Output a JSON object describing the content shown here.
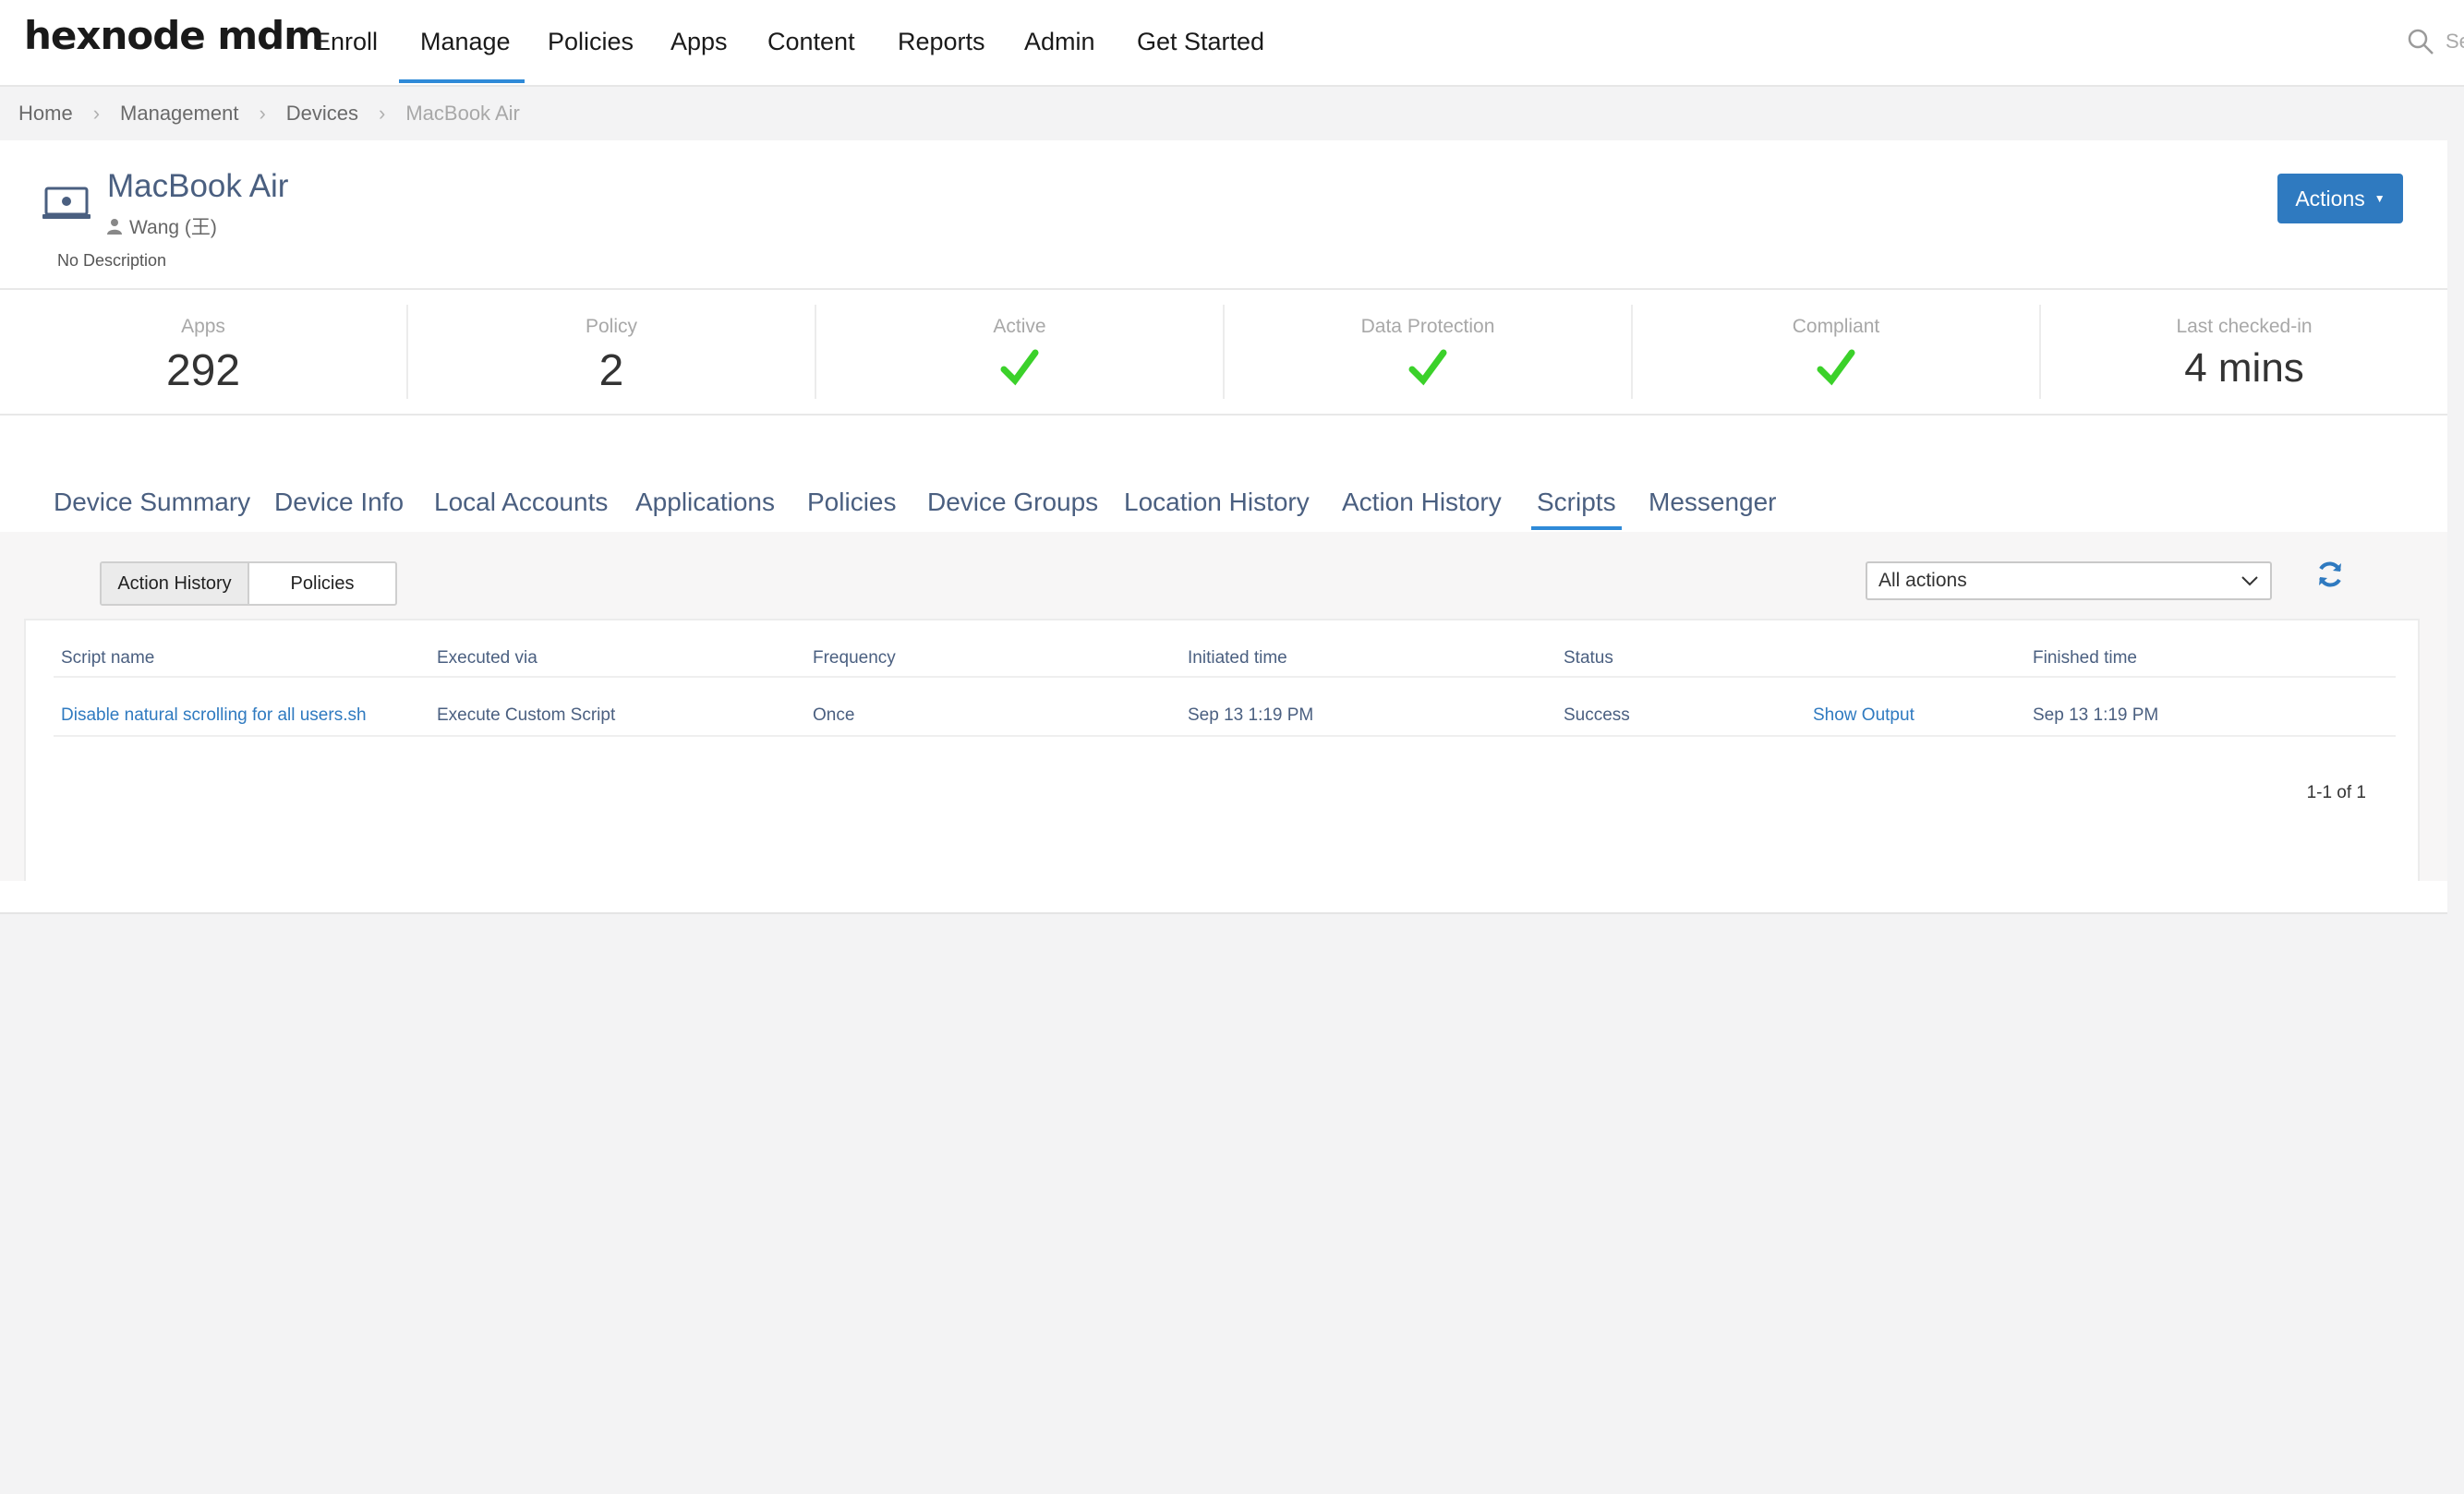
{
  "brand": {
    "logo": "hexnode mdm"
  },
  "nav": {
    "items": [
      "Enroll",
      "Manage",
      "Policies",
      "Apps",
      "Content",
      "Reports",
      "Admin",
      "Get Started"
    ],
    "active": "Manage",
    "search_hint": "Se"
  },
  "breadcrumb": [
    "Home",
    "Management",
    "Devices",
    "MacBook Air"
  ],
  "device": {
    "name": "MacBook Air",
    "user": "Wang (王)",
    "description": "No Description",
    "actions_label": "Actions"
  },
  "stats": [
    {
      "label": "Apps",
      "value": "292"
    },
    {
      "label": "Policy",
      "value": "2"
    },
    {
      "label": "Active",
      "icon": "check-icon"
    },
    {
      "label": "Data Protection",
      "icon": "check-icon"
    },
    {
      "label": "Compliant",
      "icon": "check-icon"
    },
    {
      "label": "Last checked-in",
      "value": "4 mins"
    }
  ],
  "tabs": [
    "Device Summary",
    "Device Info",
    "Local Accounts",
    "Applications",
    "Policies",
    "Device Groups",
    "Location History",
    "Action History",
    "Scripts",
    "Messenger"
  ],
  "active_tab": "Scripts",
  "scripts": {
    "toggle": [
      "Action History",
      "Policies"
    ],
    "toggle_active": "Action History",
    "filter_value": "All actions",
    "columns": [
      "Script name",
      "Executed via",
      "Frequency",
      "Initiated time",
      "Status",
      "Finished time"
    ],
    "rows": [
      {
        "script_name": "Disable natural scrolling for all users.sh",
        "executed_via": "Execute Custom Script",
        "frequency": "Once",
        "initiated_time": "Sep 13 1:19 PM",
        "status": "Success",
        "output_link": "Show Output",
        "finished_time": "Sep 13 1:19 PM"
      }
    ],
    "pagination": "1-1 of 1"
  },
  "colors": {
    "accent": "#2f8ad8",
    "button": "#2f7ac0",
    "check": "#3bd12a",
    "label_blue": "#4a5f80"
  }
}
